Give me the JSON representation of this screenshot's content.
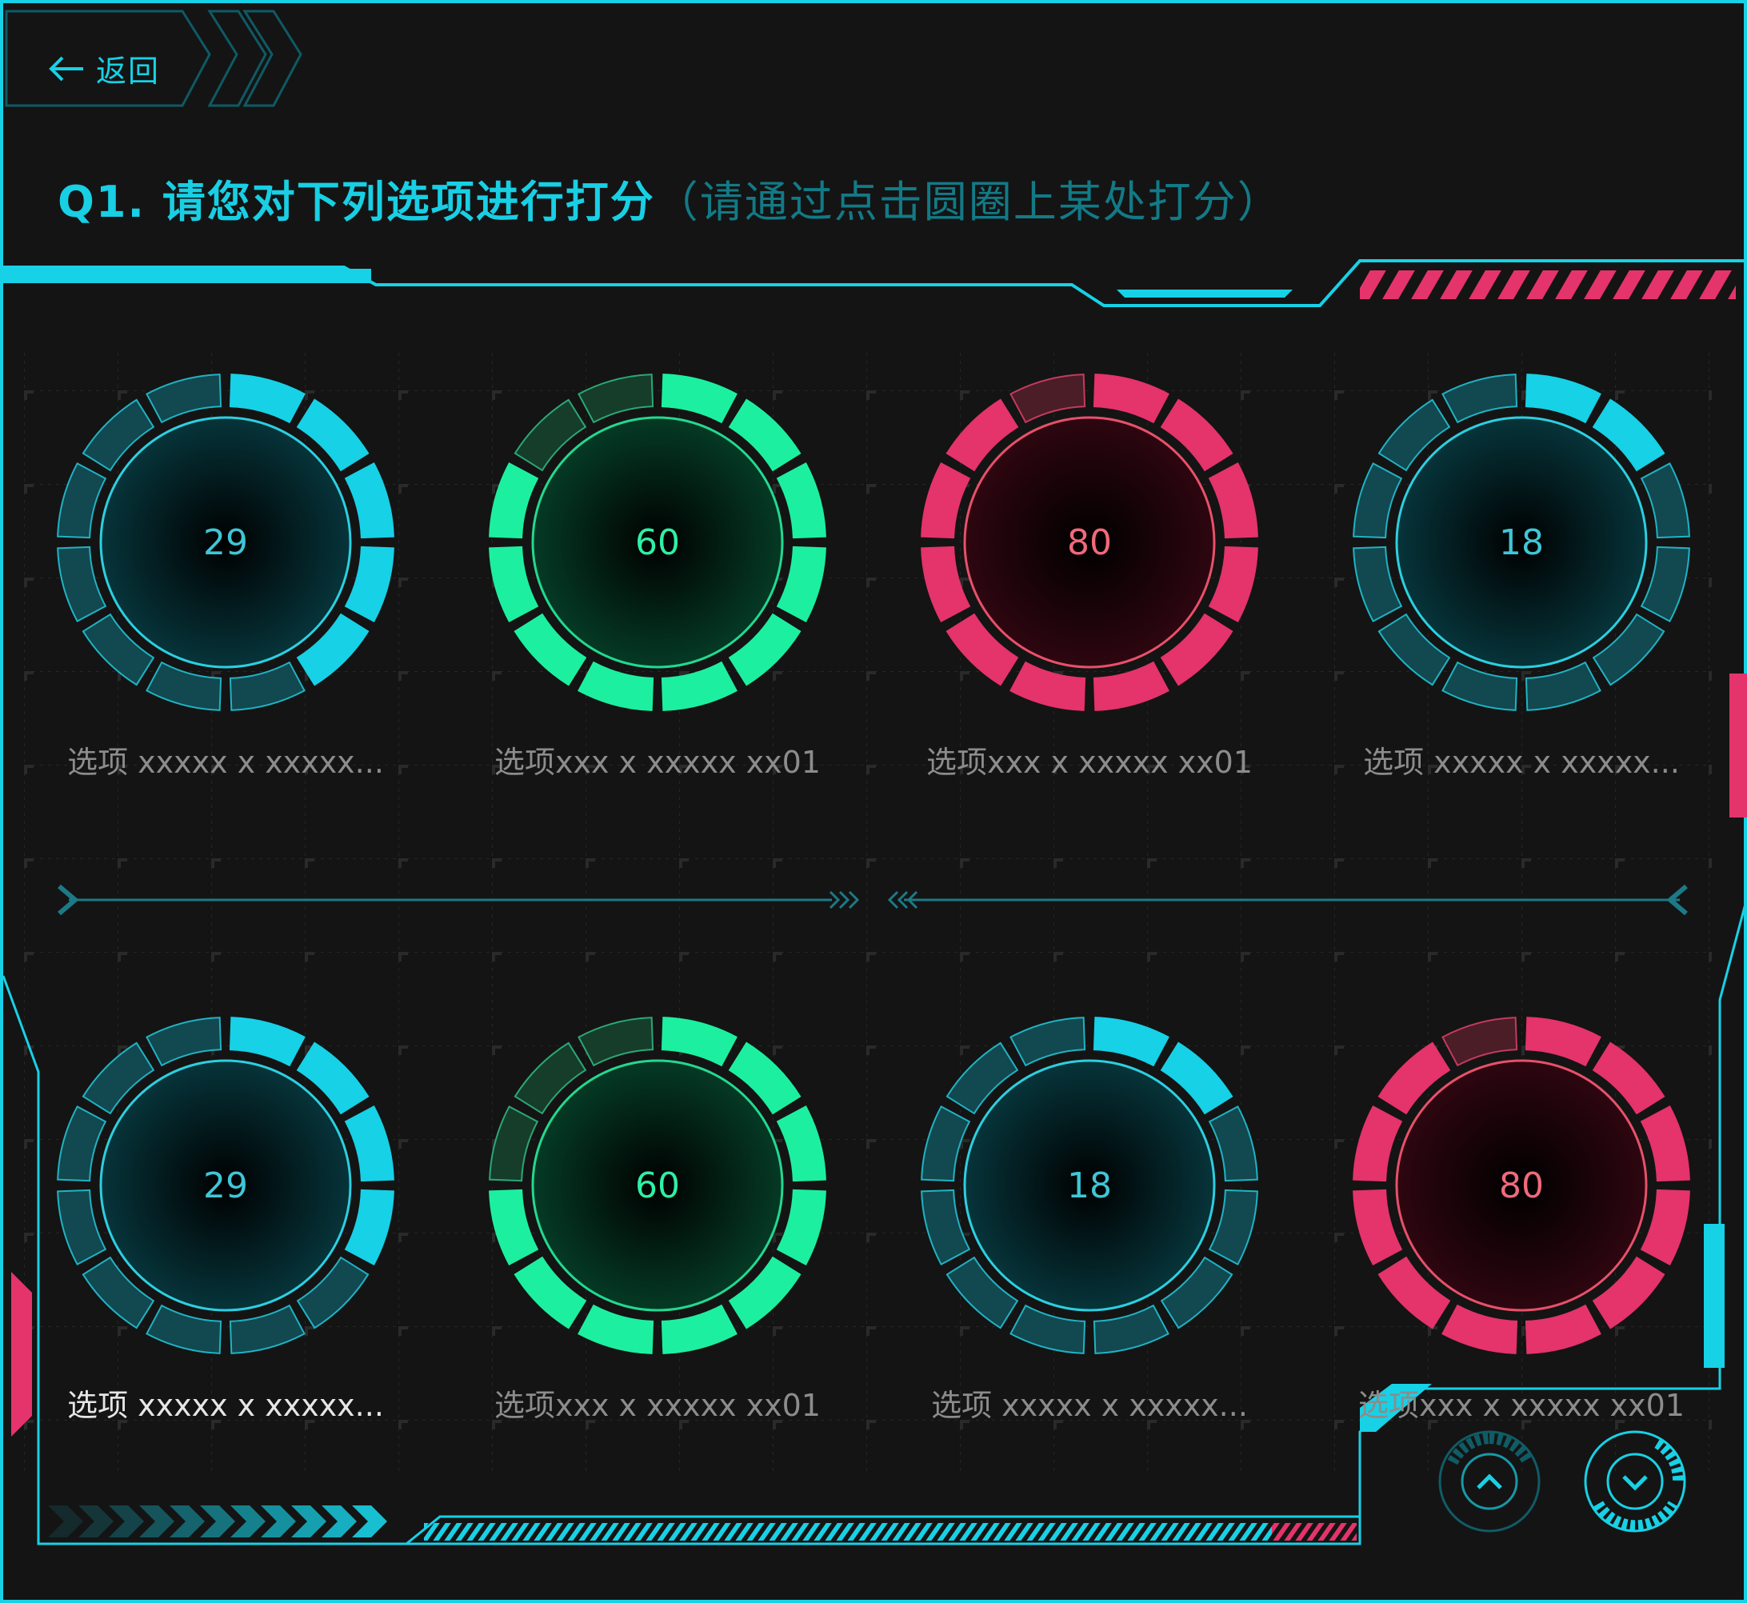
{
  "nav": {
    "back_label": "返回"
  },
  "question": {
    "title": "Q1. 请您对下列选项进行打分",
    "hint": "（请通过点击圆圈上某处打分）"
  },
  "colors": {
    "cyan": "#17d1e6",
    "green": "#1cf0a0",
    "pink": "#e5336b",
    "background": "#141414"
  },
  "ratings": [
    {
      "value": "29",
      "label": "选项 xxxxx x xxxxx...",
      "color": "cyan",
      "filled": 5,
      "label_bright": false
    },
    {
      "value": "60",
      "label": "选项xxx x xxxxx xx01",
      "color": "green",
      "filled": 10,
      "label_bright": false
    },
    {
      "value": "80",
      "label": "选项xxx x xxxxx xx01",
      "color": "pink",
      "filled": 11,
      "label_bright": false
    },
    {
      "value": "18",
      "label": "选项 xxxxx x xxxxx...",
      "color": "cyan",
      "filled": 2,
      "label_bright": false
    },
    {
      "value": "29",
      "label": "选项 xxxxx x xxxxx...",
      "color": "cyan",
      "filled": 4,
      "label_bright": true
    },
    {
      "value": "60",
      "label": "选项xxx x xxxxx xx01",
      "color": "green",
      "filled": 9,
      "label_bright": false
    },
    {
      "value": "18",
      "label": "选项 xxxxx x xxxxx...",
      "color": "cyan",
      "filled": 2,
      "label_bright": false
    },
    {
      "value": "80",
      "label": "选项xxx x xxxxx xx01",
      "color": "pink",
      "filled": 11,
      "label_bright": false
    }
  ],
  "icons": {
    "back": "arrow-left-icon",
    "scroll_up": "chevron-up-icon",
    "scroll_down": "chevron-down-icon"
  }
}
